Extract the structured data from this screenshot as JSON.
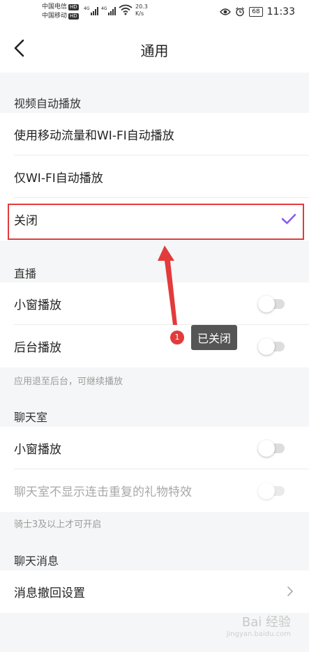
{
  "status_bar": {
    "carrier1": "中国电信",
    "carrier2": "中国移动",
    "hd": "HD",
    "network1": "4G",
    "network2": "4G",
    "speed_value": "20.3",
    "speed_unit": "K/s",
    "battery": "68",
    "time": "11:33"
  },
  "nav": {
    "title": "通用"
  },
  "video_autoplay": {
    "header": "视频自动播放",
    "options": [
      {
        "label": "使用移动流量和WI-FI自动播放",
        "selected": false
      },
      {
        "label": "仅WI-FI自动播放",
        "selected": false
      },
      {
        "label": "关闭",
        "selected": true
      }
    ]
  },
  "live": {
    "header": "直播",
    "items": [
      {
        "label": "小窗播放",
        "enabled": false
      },
      {
        "label": "后台播放",
        "enabled": false
      }
    ],
    "note": "应用退至后台，可继续播放"
  },
  "chatroom": {
    "header": "聊天室",
    "items": [
      {
        "label": "小窗播放",
        "enabled": false,
        "disabled": false
      },
      {
        "label": "聊天室不显示连击重复的礼物特效",
        "enabled": false,
        "disabled": true
      }
    ],
    "note": "骑士3及以上才可开启"
  },
  "chat_messages": {
    "header": "聊天消息",
    "item": "消息撤回设置"
  },
  "annotation": {
    "number": "1",
    "text": "已关闭",
    "color": "#e23b3b"
  },
  "watermark": {
    "text": "Bai 经验",
    "sub": "jingyan.baidu.com"
  },
  "colors": {
    "accent": "#8a5cf0",
    "highlight": "#e23b3b"
  }
}
